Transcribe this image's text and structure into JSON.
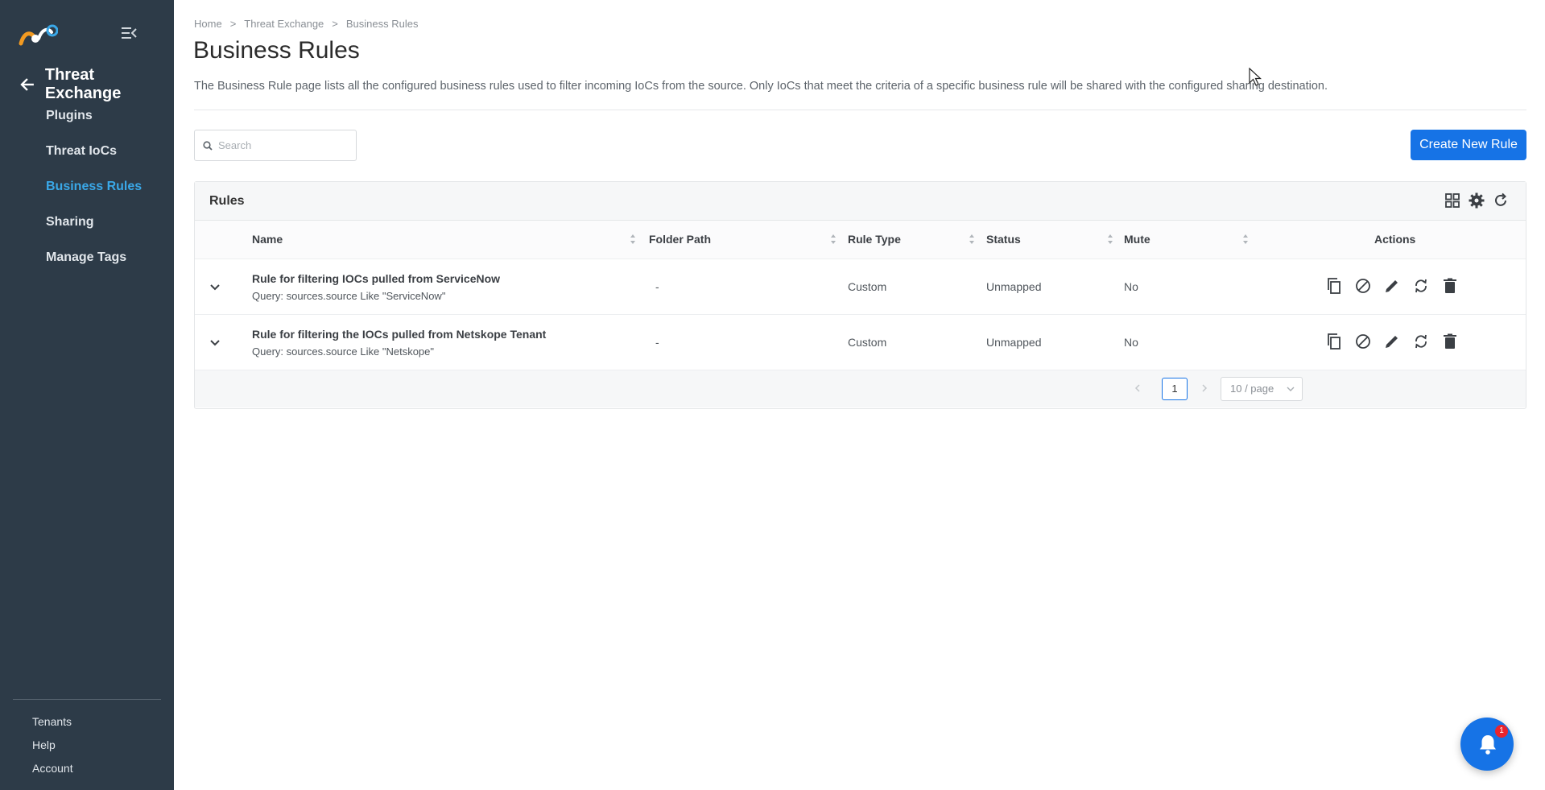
{
  "sidebar": {
    "app_title": "Threat Exchange",
    "items": [
      {
        "label": "Plugins",
        "active": false
      },
      {
        "label": "Threat IoCs",
        "active": false
      },
      {
        "label": "Business Rules",
        "active": true
      },
      {
        "label": "Sharing",
        "active": false
      },
      {
        "label": "Manage Tags",
        "active": false
      }
    ],
    "bottom_items": [
      {
        "label": "Tenants"
      },
      {
        "label": "Help"
      },
      {
        "label": "Account"
      }
    ]
  },
  "breadcrumb": {
    "items": [
      "Home",
      "Threat Exchange",
      "Business Rules"
    ],
    "separator": ">"
  },
  "page": {
    "title": "Business Rules",
    "description": "The Business Rule page lists all the configured business rules used to filter incoming IoCs from the source. Only IoCs that meet the criteria of a specific business rule will be shared with the configured sharing destination."
  },
  "search": {
    "placeholder": "Search",
    "value": ""
  },
  "create_button": "Create New Rule",
  "rules_card": {
    "title": "Rules",
    "columns": [
      "Name",
      "Folder Path",
      "Rule Type",
      "Status",
      "Mute",
      "Actions"
    ],
    "rows": [
      {
        "name": "Rule for filtering IOCs pulled from ServiceNow",
        "query": "Query: sources.source Like \"ServiceNow\"",
        "folder_path": "-",
        "rule_type": "Custom",
        "status": "Unmapped",
        "mute": "No"
      },
      {
        "name": "Rule for filtering the IOCs pulled from Netskope Tenant",
        "query": "Query: sources.source Like \"Netskope\"",
        "folder_path": "-",
        "rule_type": "Custom",
        "status": "Unmapped",
        "mute": "No"
      }
    ],
    "row_actions": [
      "copy-icon",
      "disable-icon",
      "edit-icon",
      "sync-icon",
      "delete-icon"
    ],
    "pagination": {
      "current_page": "1",
      "page_size": "10 / page"
    }
  },
  "notifications": {
    "count": "1"
  },
  "colors": {
    "sidebar_bg": "#2d3b48",
    "active_nav": "#3aa8e8",
    "primary": "#1673e6",
    "badge": "#e8242e"
  }
}
